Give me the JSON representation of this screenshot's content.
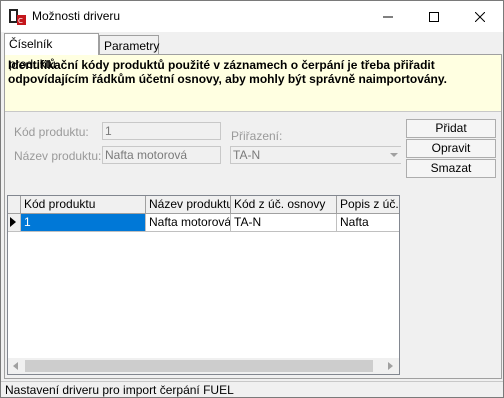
{
  "window": {
    "title": "Možnosti driveru"
  },
  "tabs": [
    {
      "label": "Číselník produktů"
    },
    {
      "label": "Parametry"
    }
  ],
  "info": {
    "text": "Identifikační kódy produktů použité v záznamech o čerpání je třeba přiřadit odpovídajícím řádkům účetní osnovy, aby mohly být správně naimportovány."
  },
  "form": {
    "product_code_label": "Kód produktu:",
    "product_code_value": "1",
    "product_name_label": "Název produktu:",
    "product_name_value": "Nafta motorová",
    "assignment_label": "Přiřazení:",
    "assignment_value": "TA-N"
  },
  "buttons": {
    "add": "Přidat",
    "edit": "Opravit",
    "delete": "Smazat"
  },
  "grid": {
    "columns": [
      "Kód produktu",
      "Název produktu",
      "Kód z úč. osnovy",
      "Popis z úč. o"
    ],
    "rows": [
      [
        "1",
        "Nafta motorová",
        "TA-N",
        "Nafta"
      ]
    ]
  },
  "status": {
    "text": "Nastavení driveru pro import čerpání FUEL"
  }
}
